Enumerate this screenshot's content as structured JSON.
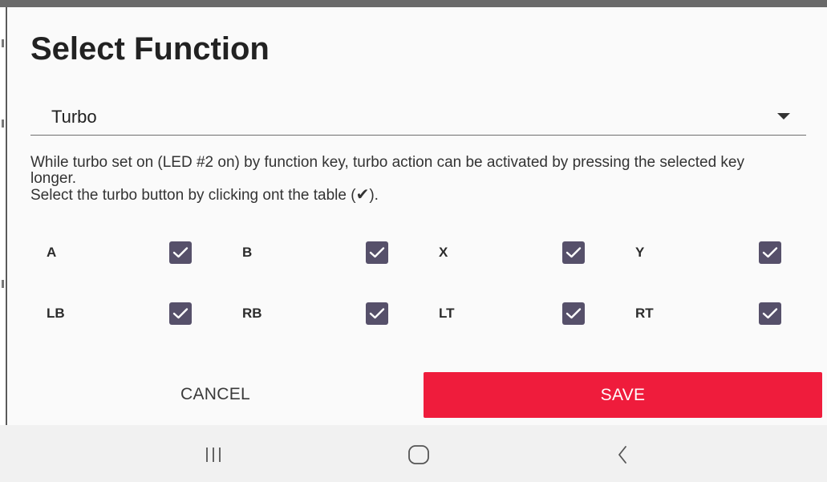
{
  "dialog": {
    "title": "Select Function",
    "select": {
      "value": "Turbo",
      "icon": "dropdown-caret-icon"
    },
    "description": {
      "line1": "While turbo set on (LED #2 on) by function key, turbo action can be activated by pressing the selected key longer.",
      "line2_prefix": "Select the turbo button by clicking ont the table (",
      "line2_glyph": "✔",
      "line2_suffix": ")."
    },
    "buttons": [
      {
        "label": "A",
        "checked": true
      },
      {
        "label": "B",
        "checked": true
      },
      {
        "label": "X",
        "checked": true
      },
      {
        "label": "Y",
        "checked": true
      },
      {
        "label": "LB",
        "checked": true
      },
      {
        "label": "RB",
        "checked": true
      },
      {
        "label": "LT",
        "checked": true
      },
      {
        "label": "RT",
        "checked": true
      }
    ],
    "actions": {
      "cancel_label": "CANCEL",
      "save_label": "SAVE"
    }
  },
  "navbar": {
    "recent_icon": "recent-apps-icon",
    "home_icon": "home-icon",
    "back_icon": "back-icon"
  },
  "colors": {
    "accent": "#ef1c3c",
    "checkbox": "#56506a",
    "navbar_bg": "#f1f1f1"
  }
}
